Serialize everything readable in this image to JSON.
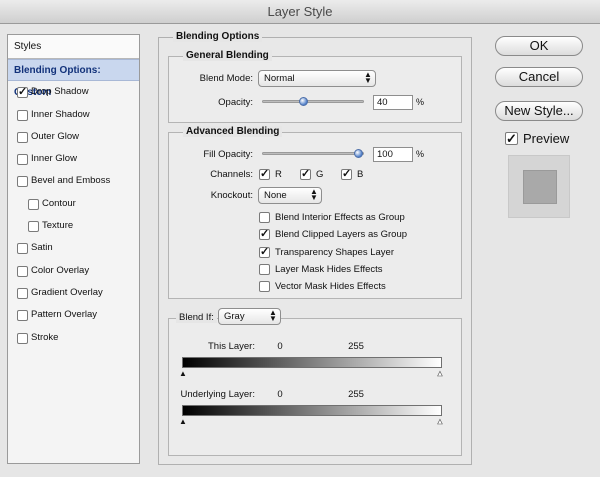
{
  "window": {
    "title": "Layer Style"
  },
  "styles_panel": {
    "header": "Styles",
    "items": [
      {
        "label": "Blending Options: Custom",
        "selected": true,
        "has_checkbox": false,
        "checked": false,
        "sub": false
      },
      {
        "label": "Drop Shadow",
        "has_checkbox": true,
        "checked": true,
        "sub": false
      },
      {
        "label": "Inner Shadow",
        "has_checkbox": true,
        "checked": false,
        "sub": false
      },
      {
        "label": "Outer Glow",
        "has_checkbox": true,
        "checked": false,
        "sub": false
      },
      {
        "label": "Inner Glow",
        "has_checkbox": true,
        "checked": false,
        "sub": false
      },
      {
        "label": "Bevel and Emboss",
        "has_checkbox": true,
        "checked": false,
        "sub": false
      },
      {
        "label": "Contour",
        "has_checkbox": true,
        "checked": false,
        "sub": true
      },
      {
        "label": "Texture",
        "has_checkbox": true,
        "checked": false,
        "sub": true
      },
      {
        "label": "Satin",
        "has_checkbox": true,
        "checked": false,
        "sub": false
      },
      {
        "label": "Color Overlay",
        "has_checkbox": true,
        "checked": false,
        "sub": false
      },
      {
        "label": "Gradient Overlay",
        "has_checkbox": true,
        "checked": false,
        "sub": false
      },
      {
        "label": "Pattern Overlay",
        "has_checkbox": true,
        "checked": false,
        "sub": false
      },
      {
        "label": "Stroke",
        "has_checkbox": true,
        "checked": false,
        "sub": false
      }
    ]
  },
  "blending_options": {
    "title": "Blending Options",
    "general": {
      "title": "General Blending",
      "blend_mode_label": "Blend Mode:",
      "blend_mode_value": "Normal",
      "opacity_label": "Opacity:",
      "opacity_value": "40",
      "opacity_fraction": 0.4,
      "opacity_unit": "%"
    },
    "advanced": {
      "title": "Advanced Blending",
      "fill_opacity_label": "Fill Opacity:",
      "fill_opacity_value": "100",
      "fill_opacity_fraction": 1.0,
      "fill_opacity_unit": "%",
      "channels_label": "Channels:",
      "channel_r": "R",
      "channel_g": "G",
      "channel_b": "B",
      "knockout_label": "Knockout:",
      "knockout_value": "None",
      "options": [
        {
          "label": "Blend Interior Effects as Group",
          "checked": false
        },
        {
          "label": "Blend Clipped Layers as Group",
          "checked": true
        },
        {
          "label": "Transparency Shapes Layer",
          "checked": true
        },
        {
          "label": "Layer Mask Hides Effects",
          "checked": false
        },
        {
          "label": "Vector Mask Hides Effects",
          "checked": false
        }
      ]
    },
    "blend_if": {
      "label": "Blend If:",
      "value": "Gray",
      "this_layer_label": "This Layer:",
      "this_layer_low": "0",
      "this_layer_high": "255",
      "underlying_label": "Underlying Layer:",
      "underlying_low": "0",
      "underlying_high": "255"
    }
  },
  "buttons": {
    "ok": "OK",
    "cancel": "Cancel",
    "new_style": "New Style...",
    "preview_label": "Preview",
    "preview_checked": true
  },
  "check_glyph": "✓"
}
